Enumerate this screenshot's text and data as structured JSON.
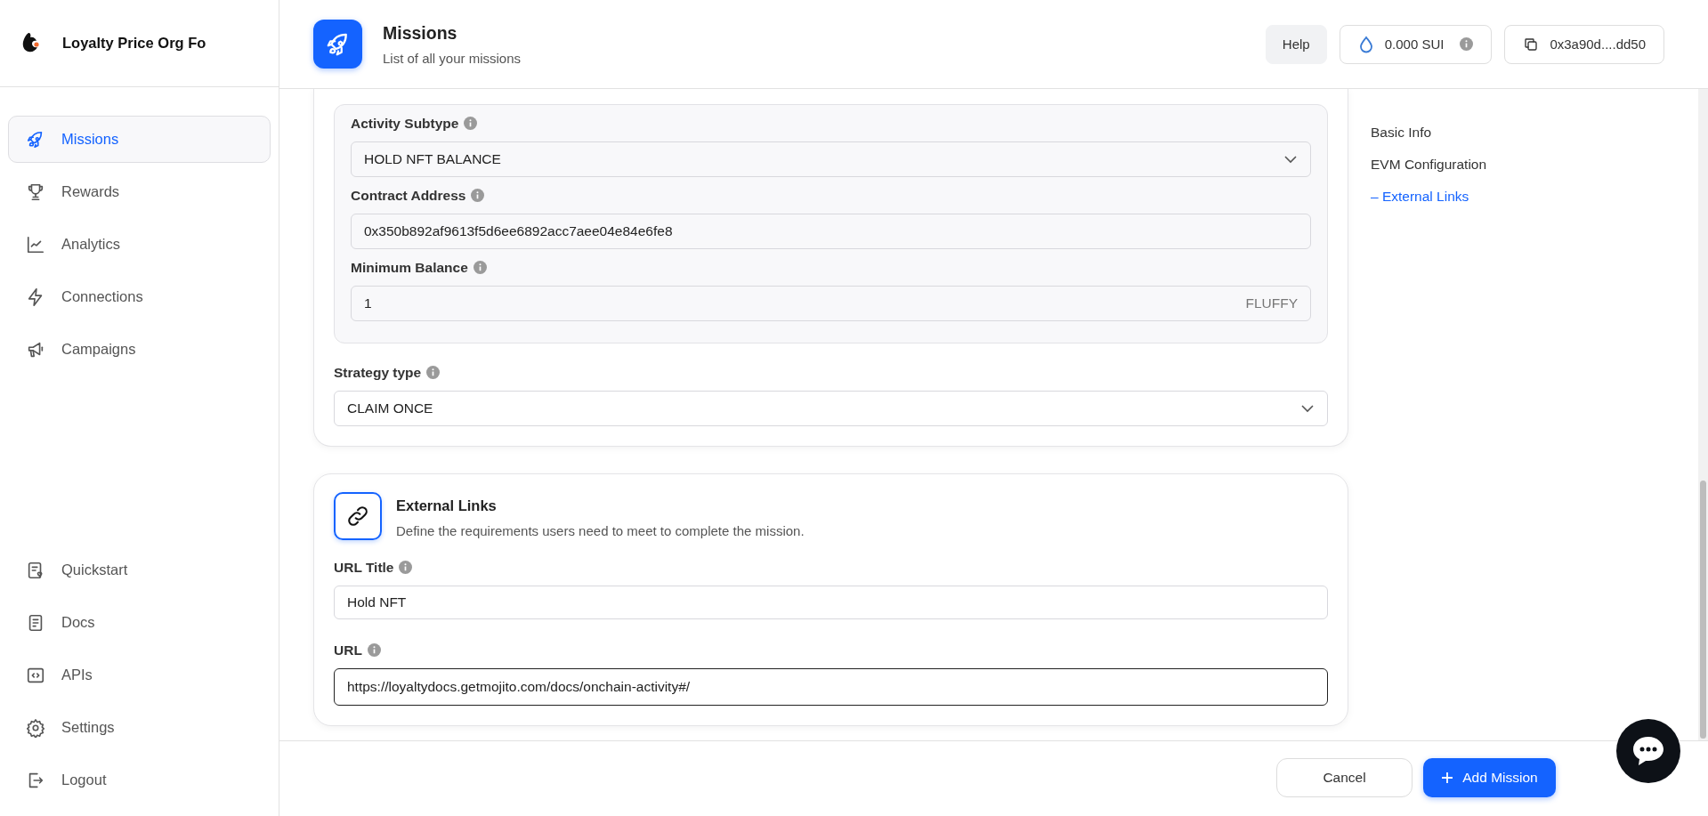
{
  "sidebar": {
    "org_name": "Loyalty Price Org Fo",
    "items": [
      {
        "label": "Missions",
        "selected": true
      },
      {
        "label": "Rewards",
        "selected": false
      },
      {
        "label": "Analytics",
        "selected": false
      },
      {
        "label": "Connections",
        "selected": false
      },
      {
        "label": "Campaigns",
        "selected": false
      }
    ],
    "bottom_items": [
      {
        "label": "Quickstart"
      },
      {
        "label": "Docs"
      },
      {
        "label": "APIs"
      },
      {
        "label": "Settings"
      },
      {
        "label": "Logout"
      }
    ]
  },
  "header": {
    "title": "Missions",
    "subtitle": "List of all your missions",
    "help_button": "Help",
    "balance": "0.000 SUI",
    "wallet": "0x3a90d....dd50"
  },
  "form": {
    "activity_fields": [
      {
        "label": "Activity Subtype",
        "kind": "select",
        "value": "HOLD NFT BALANCE"
      },
      {
        "label": "Contract Address",
        "kind": "input",
        "value": "0x350b892af9613f5d6ee6892acc7aee04e84e6fe8"
      },
      {
        "label": "Minimum Balance",
        "kind": "input",
        "value": "1",
        "suffix": "FLUFFY"
      }
    ],
    "strategy": {
      "label": "Strategy type",
      "value": "CLAIM ONCE"
    },
    "external_links": {
      "title": "External Links",
      "description": "Define the requirements users need to meet to complete the mission.",
      "fields": [
        {
          "label": "URL Title",
          "value": "Hold NFT",
          "focused": false
        },
        {
          "label": "URL",
          "value": "https://loyaltydocs.getmojito.com/docs/onchain-activity#/",
          "focused": true
        }
      ]
    }
  },
  "page_nav": [
    {
      "label": "Basic Info",
      "selected": false
    },
    {
      "label": "EVM Configuration",
      "selected": false
    },
    {
      "label": "– External Links",
      "selected": true
    }
  ],
  "footer": {
    "cancel_button": "Cancel",
    "add_button": "Add Mission"
  }
}
